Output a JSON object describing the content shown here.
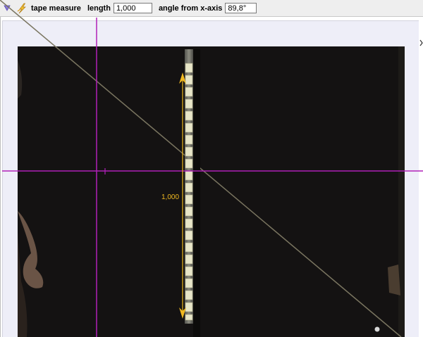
{
  "toolbar": {
    "tool_menu_icon": "triangle-down-icon",
    "tool_icon": "lightning-bolt-icon",
    "tool_name": "tape measure",
    "length_label": "length",
    "length_value": "1,000",
    "angle_label": "angle from x-axis",
    "angle_value": "89,8°"
  },
  "video": {
    "tape_readout": "1,000"
  },
  "colors": {
    "axes": "#b020b8",
    "tape": "#f0b820",
    "video_background": "#141212",
    "canvas_background": "#eeeef8"
  }
}
